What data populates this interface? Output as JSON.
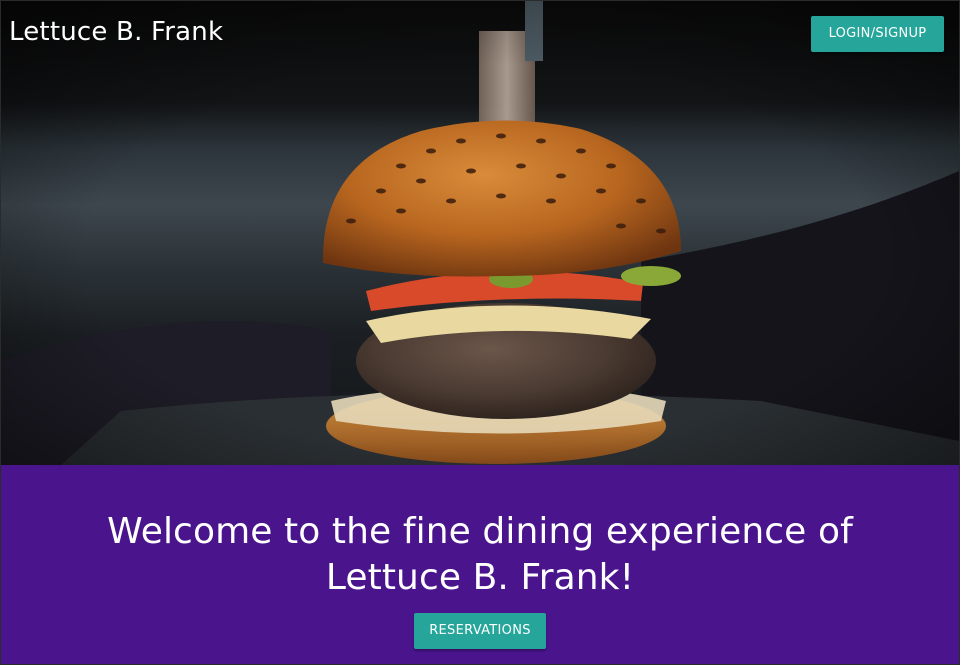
{
  "header": {
    "brand": "Lettuce B. Frank",
    "login_label": "LOGIN/SIGNUP"
  },
  "hero": {
    "image_subject": "burger-photo"
  },
  "welcome": {
    "line1": "Welcome to the fine dining experience of",
    "line2": "Lettuce B. Frank!",
    "reservations_label": "RESERVATIONS"
  },
  "colors": {
    "accent_button": "#26a69a",
    "welcome_band": "#4a148c",
    "brand_text": "#ffffff"
  }
}
